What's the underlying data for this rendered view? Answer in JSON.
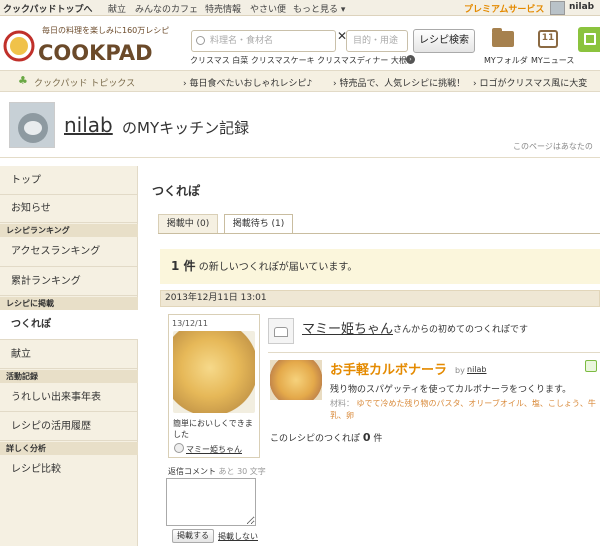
{
  "topnav": {
    "home": "クックパッドトップへ",
    "links": [
      "献立",
      "みんなのカフェ",
      "特売情報",
      "やさい便",
      "もっと見る ▾"
    ],
    "premium": "プレミアムサービス",
    "user": "nilab"
  },
  "header": {
    "tagline": "毎日の料理を楽しみに160万レシピ",
    "logo": "COOKPAD",
    "search_placeholder": "料理名・食材名",
    "purpose_placeholder": "目的・用途",
    "clear": "✕",
    "search_button": "レシピ検索",
    "keywords": "クリスマス 白菜 クリスマスケーキ クリスマスディナー 大根",
    "myfolder": "MYフォルダ",
    "mynews": "MYニュース",
    "calendar_day": "11"
  },
  "topics": {
    "label": "クックパッド トピックス",
    "items": [
      "毎日食べたいおしゃれレシピ♪",
      "特売品で、人気レシピに挑戦！",
      "ロゴがクリスマス風に大変"
    ]
  },
  "profile": {
    "username": "nilab",
    "title": "のMYキッチン記録",
    "note": "このページはあなたの"
  },
  "sidebar": {
    "items": [
      {
        "type": "item",
        "label": "トップ"
      },
      {
        "type": "item",
        "label": "お知らせ"
      },
      {
        "type": "section",
        "label": "レシピランキング"
      },
      {
        "type": "item",
        "label": "アクセスランキング"
      },
      {
        "type": "item",
        "label": "累計ランキング"
      },
      {
        "type": "section",
        "label": "レシピに掲載"
      },
      {
        "type": "item",
        "label": "つくれぽ",
        "active": true
      },
      {
        "type": "item",
        "label": "献立"
      },
      {
        "type": "section",
        "label": "活動記録"
      },
      {
        "type": "item",
        "label": "うれしい出来事年表"
      },
      {
        "type": "item",
        "label": "レシピの活用履歴"
      },
      {
        "type": "section",
        "label": "詳しく分析"
      },
      {
        "type": "item",
        "label": "レシピ比較"
      }
    ]
  },
  "main": {
    "title": "つくれぽ",
    "tabs": [
      {
        "label": "掲載中 (0)",
        "active": false
      },
      {
        "label": "掲載待ち (1)",
        "active": true
      }
    ],
    "notice_count": "1 件",
    "notice_text": "の新しいつくれぽが届いています。",
    "date": "2013年12月11日 13:01",
    "card": {
      "date": "13/12/11",
      "comment": "簡単においしくできました",
      "user": "マミー姫ちゃん"
    },
    "reply_label": "返信コメント",
    "reply_hint": "あと 30 文字",
    "post_button": "掲載する",
    "nopost_link": "掲載しない",
    "sender": "マミー姫ちゃん",
    "sender_suffix": "さんからの初めてのつくれぽです",
    "recipe": {
      "title": "お手軽カルボナーラ",
      "by": "by",
      "author": "nilab",
      "desc": "残り物のスパゲッティを使ってカルボナーラをつくります。",
      "ingredients_label": "材料：",
      "ingredients": "ゆでて冷めた残り物のパスタ、オリーブオイル、塩、こしょう、牛乳、卵",
      "count_prefix": "このレシピのつくれぽ",
      "count": "0",
      "count_suffix": "件"
    }
  },
  "colors": {
    "accent": "#e48a00",
    "sidebar_bg": "#f5f0e2",
    "section_bg": "#e8dfc8",
    "notice_bg": "#fbf6dc"
  }
}
